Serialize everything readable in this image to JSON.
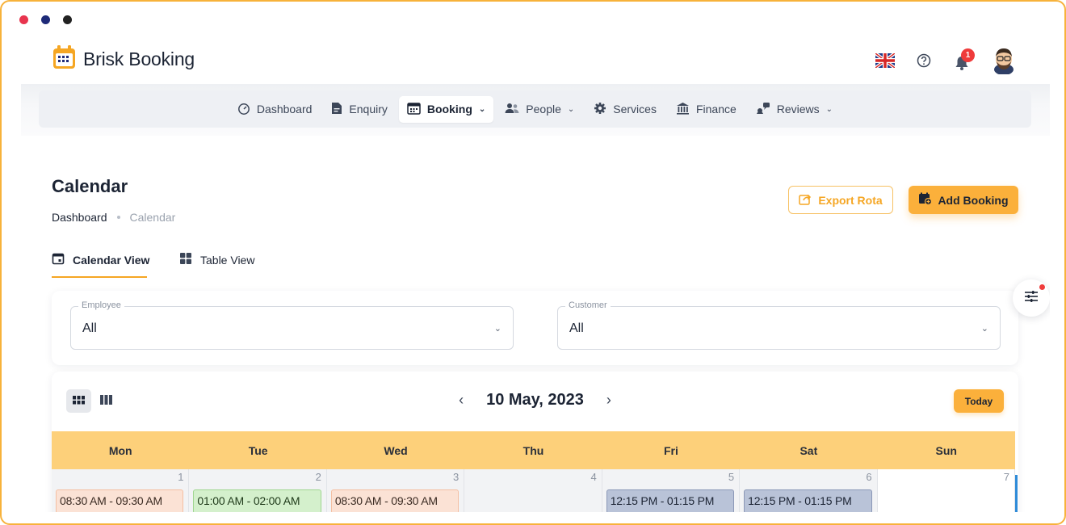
{
  "window": {
    "dots": [
      {
        "name": "red-dot",
        "color": "#e8344e"
      },
      {
        "name": "navy-dot",
        "color": "#1e2a78"
      },
      {
        "name": "dark-dot",
        "color": "#222222"
      }
    ]
  },
  "header": {
    "brand": "Brisk Booking",
    "notification_count": "1",
    "language_icon": "uk-flag-icon",
    "help_icon": "help-icon",
    "bell_icon": "bell-icon",
    "avatar_icon": "avatar"
  },
  "nav": {
    "items": [
      {
        "label": "Dashboard",
        "icon": "gauge-icon"
      },
      {
        "label": "Enquiry",
        "icon": "document-icon"
      },
      {
        "label": "Booking",
        "icon": "calendar-icon"
      },
      {
        "label": "People",
        "icon": "people-icon"
      },
      {
        "label": "Services",
        "icon": "gear-icon"
      },
      {
        "label": "Finance",
        "icon": "bank-icon"
      },
      {
        "label": "Reviews",
        "icon": "reviews-icon"
      }
    ],
    "active": "Booking"
  },
  "page": {
    "title": "Calendar",
    "breadcrumb": [
      "Dashboard",
      "Calendar"
    ],
    "export_label": "Export Rota",
    "add_label": "Add Booking"
  },
  "tabs": {
    "calendar": "Calendar View",
    "table": "Table View",
    "active": "Calendar View"
  },
  "filters": {
    "employee": {
      "label": "Employee",
      "value": "All"
    },
    "customer": {
      "label": "Customer",
      "value": "All"
    }
  },
  "calendar": {
    "title": "10 May, 2023",
    "today_label": "Today",
    "days": [
      "Mon",
      "Tue",
      "Wed",
      "Thu",
      "Fri",
      "Sat",
      "Sun"
    ],
    "dates": [
      "1",
      "2",
      "3",
      "4",
      "5",
      "6",
      "7"
    ],
    "events": [
      "08:30 AM - 09:30 AM",
      "01:00 AM - 02:00 AM",
      "08:30 AM - 09:30 AM",
      "",
      "12:15 PM - 01:15 PM",
      "12:15 PM - 01:15 PM",
      ""
    ]
  },
  "colors": {
    "accent": "#fbb03b",
    "header_row": "#fdd07a",
    "event_orange": "#fbe2d5",
    "event_green": "#d4f0cc",
    "event_blue": "#b9c3d8"
  }
}
